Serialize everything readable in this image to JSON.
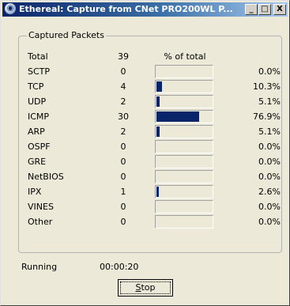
{
  "window": {
    "title": "Ethereal: Capture from CNet PRO200WL P...",
    "min_label": "_",
    "max_label": "□",
    "close_label": "X"
  },
  "group": {
    "legend": "Captured Packets",
    "total_label": "Total",
    "total_count": "39",
    "pct_header": "% of total",
    "rows": [
      {
        "label": "SCTP",
        "count": "0",
        "pct": "0.0%",
        "fraction": 0.0
      },
      {
        "label": "TCP",
        "count": "4",
        "pct": "10.3%",
        "fraction": 0.103
      },
      {
        "label": "UDP",
        "count": "2",
        "pct": "5.1%",
        "fraction": 0.051
      },
      {
        "label": "ICMP",
        "count": "30",
        "pct": "76.9%",
        "fraction": 0.769
      },
      {
        "label": "ARP",
        "count": "2",
        "pct": "5.1%",
        "fraction": 0.051
      },
      {
        "label": "OSPF",
        "count": "0",
        "pct": "0.0%",
        "fraction": 0.0
      },
      {
        "label": "GRE",
        "count": "0",
        "pct": "0.0%",
        "fraction": 0.0
      },
      {
        "label": "NetBIOS",
        "count": "0",
        "pct": "0.0%",
        "fraction": 0.0
      },
      {
        "label": "IPX",
        "count": "1",
        "pct": "2.6%",
        "fraction": 0.026
      },
      {
        "label": "VINES",
        "count": "0",
        "pct": "0.0%",
        "fraction": 0.0
      },
      {
        "label": "Other",
        "count": "0",
        "pct": "0.0%",
        "fraction": 0.0
      }
    ]
  },
  "status": {
    "label": "Running",
    "elapsed": "00:00:20"
  },
  "stop_button": {
    "label": "Stop"
  },
  "colors": {
    "bar_fill": "#0a246a",
    "title_gradient_start": "#0a246a",
    "dialog_bg": "#ece9d8"
  }
}
